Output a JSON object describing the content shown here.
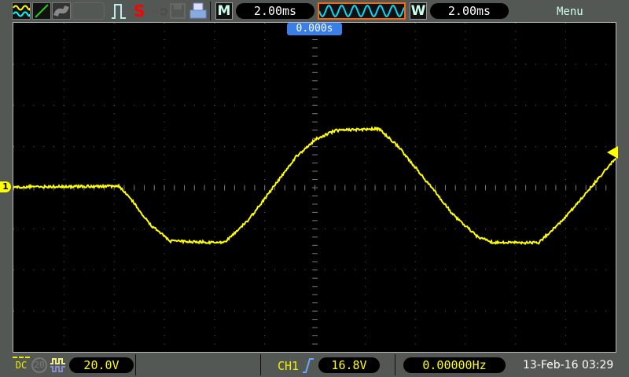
{
  "toolbar": {
    "icons": [
      "channel-waveform-icon",
      "math-line-icon",
      "persistence-icon",
      "trigger-pulse-icon",
      "stop-icon",
      "key-lock-icon",
      "save-disk-icon",
      "printer-icon"
    ],
    "run_state": "S",
    "main_timebase_label": "M",
    "main_timebase": "2.00ms",
    "window_label": "W",
    "window_timebase": "2.00ms",
    "menu_label": "Menu"
  },
  "screen": {
    "trigger_time": "0.000s",
    "channel_marker": "1",
    "trace_color": "#ffff00",
    "grid_divisions": {
      "horizontal": 12,
      "vertical": 8
    }
  },
  "status": {
    "coupling": "DC",
    "bandwidth_limit": "20",
    "ch_scale": "20.0V",
    "trigger_source": "CH1",
    "trigger_edge": "rising",
    "trigger_level": "16.8V",
    "frequency": "0.00000Hz",
    "datetime": "13-Feb-16 03:29"
  }
}
